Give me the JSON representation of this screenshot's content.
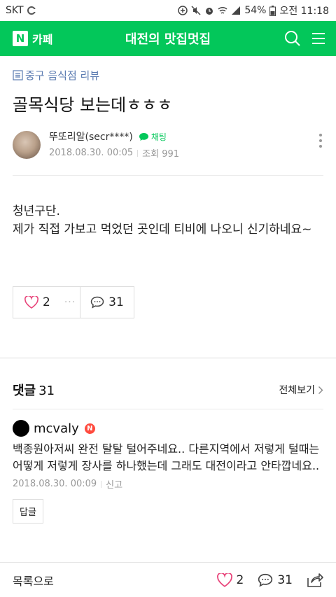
{
  "status_bar": {
    "carrier": "SKT",
    "battery": "54%",
    "time": "오전 11:18"
  },
  "header": {
    "brand_letter": "N",
    "brand_label": "카페",
    "cafe_title": "대전의 맛집멋집"
  },
  "post": {
    "board": "중구 음식점 리뷰",
    "title": "골목식당 보는데ㅎㅎㅎ",
    "author": "뚜또리알(secr****)",
    "chat_label": "채팅",
    "date": "2018.08.30. 00:05",
    "views": "조회 991",
    "body_lines": [
      "청년구단.",
      "제가 직접 가보고 먹었던 곳인데 티비에 나오니 신기하네요~"
    ],
    "likes": "2",
    "comments": "31"
  },
  "comments_section": {
    "title": "댓글",
    "count": "31",
    "view_all": "전체보기",
    "items": [
      {
        "author": "mcvaly",
        "badge": "N",
        "text": "백종원아저씨 완전 탈탈 털어주네요.. 다른지역에서 저렇게 털때는 어떻게 저렇게 장사를 하나했는데 그래도 대전이라고 안타깝네요..",
        "date": "2018.08.30. 00:09",
        "report": "신고",
        "reply": "답글"
      }
    ]
  },
  "bottom_bar": {
    "list_label": "목록으로",
    "likes": "2",
    "comments": "31"
  },
  "colors": {
    "brand_green": "#03c75a",
    "board_blue": "#5b7bb1",
    "heart_pink": "#e8447a",
    "badge_red": "#ff4a3d"
  }
}
